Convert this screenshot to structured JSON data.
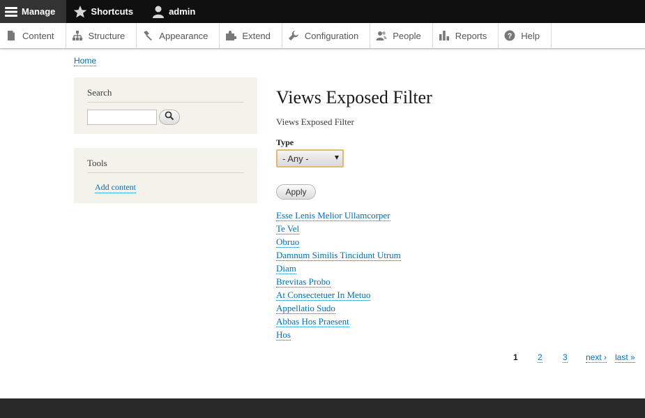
{
  "toolbar": {
    "manage_label": "Manage",
    "shortcuts_label": "Shortcuts",
    "user_label": "admin",
    "manage_icon": "hamburger-icon",
    "shortcuts_icon": "star-icon",
    "user_icon": "user-icon",
    "bar_color": "#0f0f0f",
    "active_color": "#333333"
  },
  "tray": {
    "items": [
      {
        "label": "Content",
        "icon": "file-icon"
      },
      {
        "label": "Structure",
        "icon": "sitemap-icon"
      },
      {
        "label": "Appearance",
        "icon": "paintbrush-icon"
      },
      {
        "label": "Extend",
        "icon": "puzzle-icon"
      },
      {
        "label": "Configuration",
        "icon": "wrench-icon"
      },
      {
        "label": "People",
        "icon": "people-icon"
      },
      {
        "label": "Reports",
        "icon": "bar-chart-icon"
      },
      {
        "label": "Help",
        "icon": "help-icon"
      }
    ]
  },
  "breadcrumb": {
    "home": "Home"
  },
  "sidebar": {
    "search_title": "Search",
    "search_value": "",
    "tools_title": "Tools",
    "add_content": "Add content"
  },
  "main": {
    "title": "Views Exposed Filter",
    "subtitle": "Views Exposed Filter",
    "filter_label": "Type",
    "filter_value": "- Any -",
    "apply_label": "Apply",
    "results": [
      "Esse Lenis Melior Ullamcorper",
      "Te Vel",
      "Obruo",
      "Damnum Similis Tincidunt Utrum",
      "Diam",
      "Brevitas Probo",
      "At Consectetuer In Metuo",
      "Appellatio Sudo",
      "Abbas Hos Praesent",
      "Hos"
    ]
  },
  "pager": {
    "current": "1",
    "page2": "2",
    "page3": "3",
    "next": "next ›",
    "last": "last »"
  },
  "colors": {
    "link": "#0071b3",
    "sidebar_bg": "#f3f3ec",
    "select_border": "#e5b96a",
    "footer_bg": "#292929"
  }
}
